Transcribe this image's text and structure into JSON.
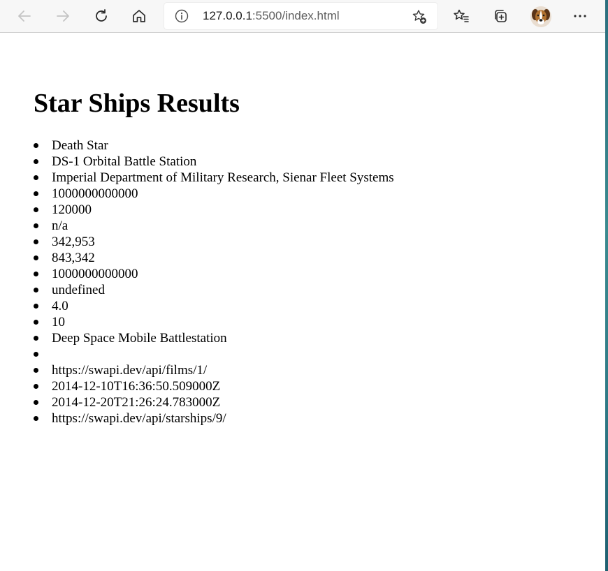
{
  "browser": {
    "url_host": "127.0.0.1",
    "url_rest": ":5500/index.html"
  },
  "page": {
    "heading": "Star Ships Results",
    "items": [
      "Death Star",
      "DS-1 Orbital Battle Station",
      "Imperial Department of Military Research, Sienar Fleet Systems",
      "1000000000000",
      "120000",
      "n/a",
      "342,953",
      "843,342",
      "1000000000000",
      "undefined",
      "4.0",
      "10",
      "Deep Space Mobile Battlestation",
      "",
      "https://swapi.dev/api/films/1/",
      "2014-12-10T16:36:50.509000Z",
      "2014-12-20T21:26:24.783000Z",
      "https://swapi.dev/api/starships/9/"
    ]
  }
}
